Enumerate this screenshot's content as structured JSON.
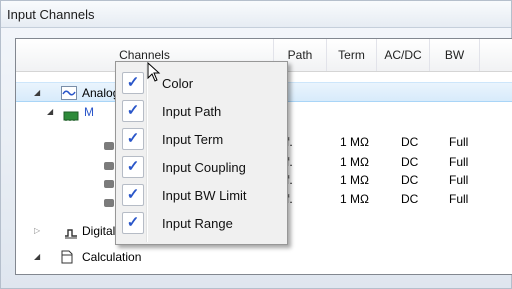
{
  "window": {
    "title": "Input Channels"
  },
  "columns": [
    {
      "label": "Channels"
    },
    {
      "label": "Path"
    },
    {
      "label": "Term"
    },
    {
      "label": "AC/DC"
    },
    {
      "label": "BW"
    }
  ],
  "tree": {
    "analog": {
      "label": "Analog",
      "expanded": true
    },
    "module": {
      "label": "M",
      "expanded": true
    },
    "channels": [
      {
        "path": "f.",
        "term": "1 MΩ",
        "coupling": "DC",
        "bw": "Full"
      },
      {
        "path": "f.",
        "term": "1 MΩ",
        "coupling": "DC",
        "bw": "Full"
      },
      {
        "path": "f.",
        "term": "1 MΩ",
        "coupling": "DC",
        "bw": "Full"
      },
      {
        "path": "f.",
        "term": "1 MΩ",
        "coupling": "DC",
        "bw": "Full"
      }
    ],
    "digital": {
      "label": "Digital",
      "expanded": false
    },
    "calculation": {
      "label": "Calculation",
      "expanded": true
    }
  },
  "context_menu": {
    "items": [
      {
        "label": "Color",
        "checked": true
      },
      {
        "label": "Input Path",
        "checked": true
      },
      {
        "label": "Input Term",
        "checked": true
      },
      {
        "label": "Input Coupling",
        "checked": true
      },
      {
        "label": "Input BW Limit",
        "checked": true
      },
      {
        "label": "Input Range",
        "checked": true
      }
    ]
  },
  "colors": {
    "accent": "#2a56c9",
    "selection": "#d8ebfb",
    "module_icon": "#2e8b3a"
  }
}
